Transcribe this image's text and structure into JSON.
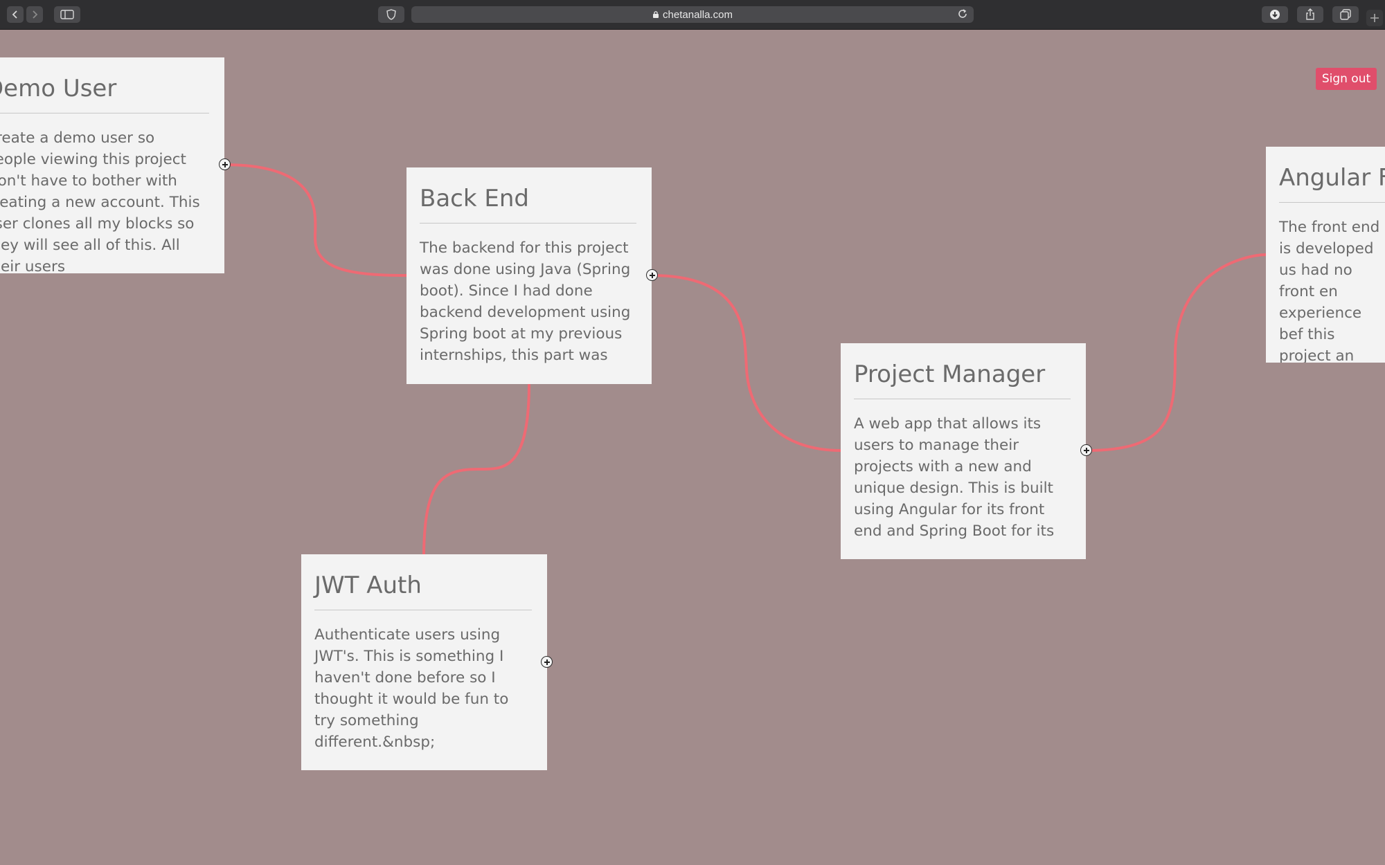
{
  "browser": {
    "url": "chetanalla.com",
    "icons": [
      "back-icon",
      "forward-icon",
      "sidebar-icon",
      "shield-icon",
      "lock-icon",
      "reload-icon",
      "download-icon",
      "share-icon",
      "tabs-icon",
      "new-tab-icon"
    ]
  },
  "app": {
    "signout_label": "Sign out",
    "accent": "#e04e6b",
    "connector_color": "#ee6a74",
    "canvas_color": "#a28c8c"
  },
  "cards": {
    "demo_user": {
      "title": "Demo User",
      "body": "Create a demo user so people viewing this project won't have to bother with creating a new account. This user clones all my blocks so they will see all of this. All their users"
    },
    "back_end": {
      "title": "Back End",
      "body": "The backend for this project was done using Java (Spring boot). Since I had done backend development using Spring boot at my previous internships, this part was"
    },
    "project_manager": {
      "title": "Project Manager",
      "body": "A web app that allows its users to manage their projects with a new and unique design. This is built using Angular for its front end and Spring Boot for its"
    },
    "jwt_auth": {
      "title": "JWT Auth",
      "body": "Authenticate users using JWT's. This is something I haven't done before so I thought it would be fun to try something different.&nbsp;"
    },
    "angular_front": {
      "title": "Angular Fr",
      "body": "The front end is developed us had no front en experience bef this project an learned so muc"
    }
  }
}
